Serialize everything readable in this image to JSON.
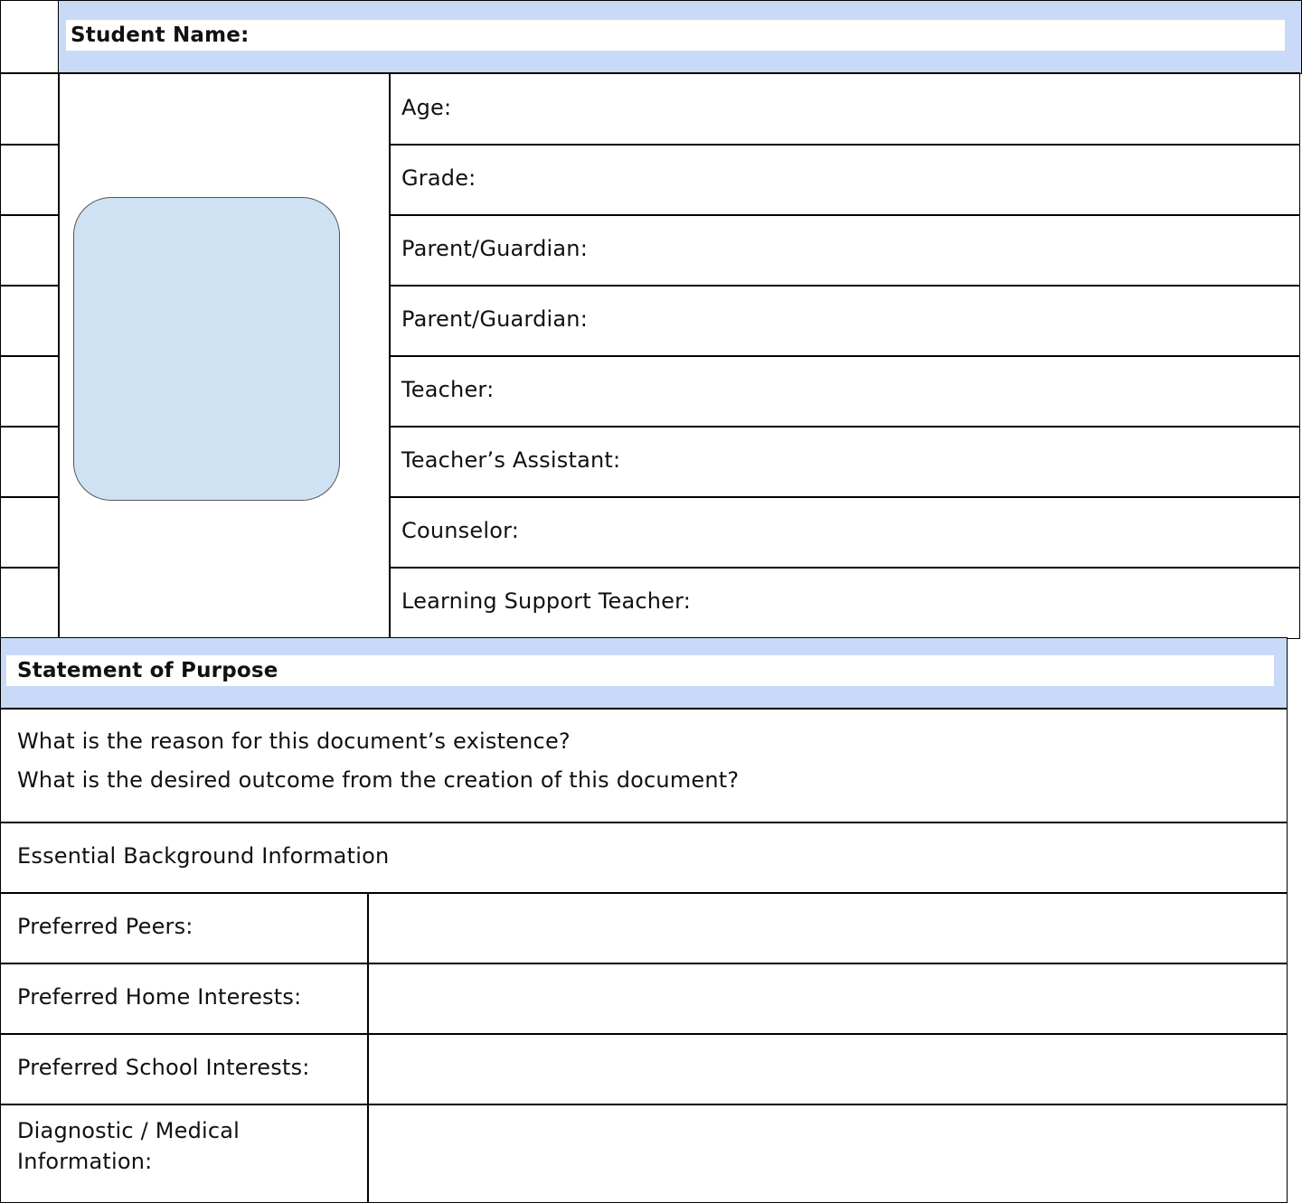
{
  "header": {
    "student_name_label": "Student Name:"
  },
  "profile_fields": [
    "Age:",
    "Grade:",
    "Parent/Guardian:",
    "Parent/Guardian:",
    "Teacher:",
    "Teacher’s Assistant:",
    "Counselor:",
    "Learning Support Teacher:"
  ],
  "purpose": {
    "title": "Statement of Purpose",
    "line1": "What is the reason for this document’s existence?",
    "line2": "What is the desired outcome from the creation of this document?"
  },
  "background": {
    "title": "Essential Background Information"
  },
  "preferences": [
    "Preferred Peers:",
    "Preferred Home Interests:",
    "Preferred School Interests:",
    "Diagnostic / Medical Information:"
  ],
  "colors": {
    "header_fill": "#c9daf8",
    "photo_fill": "#cfe2f3"
  }
}
